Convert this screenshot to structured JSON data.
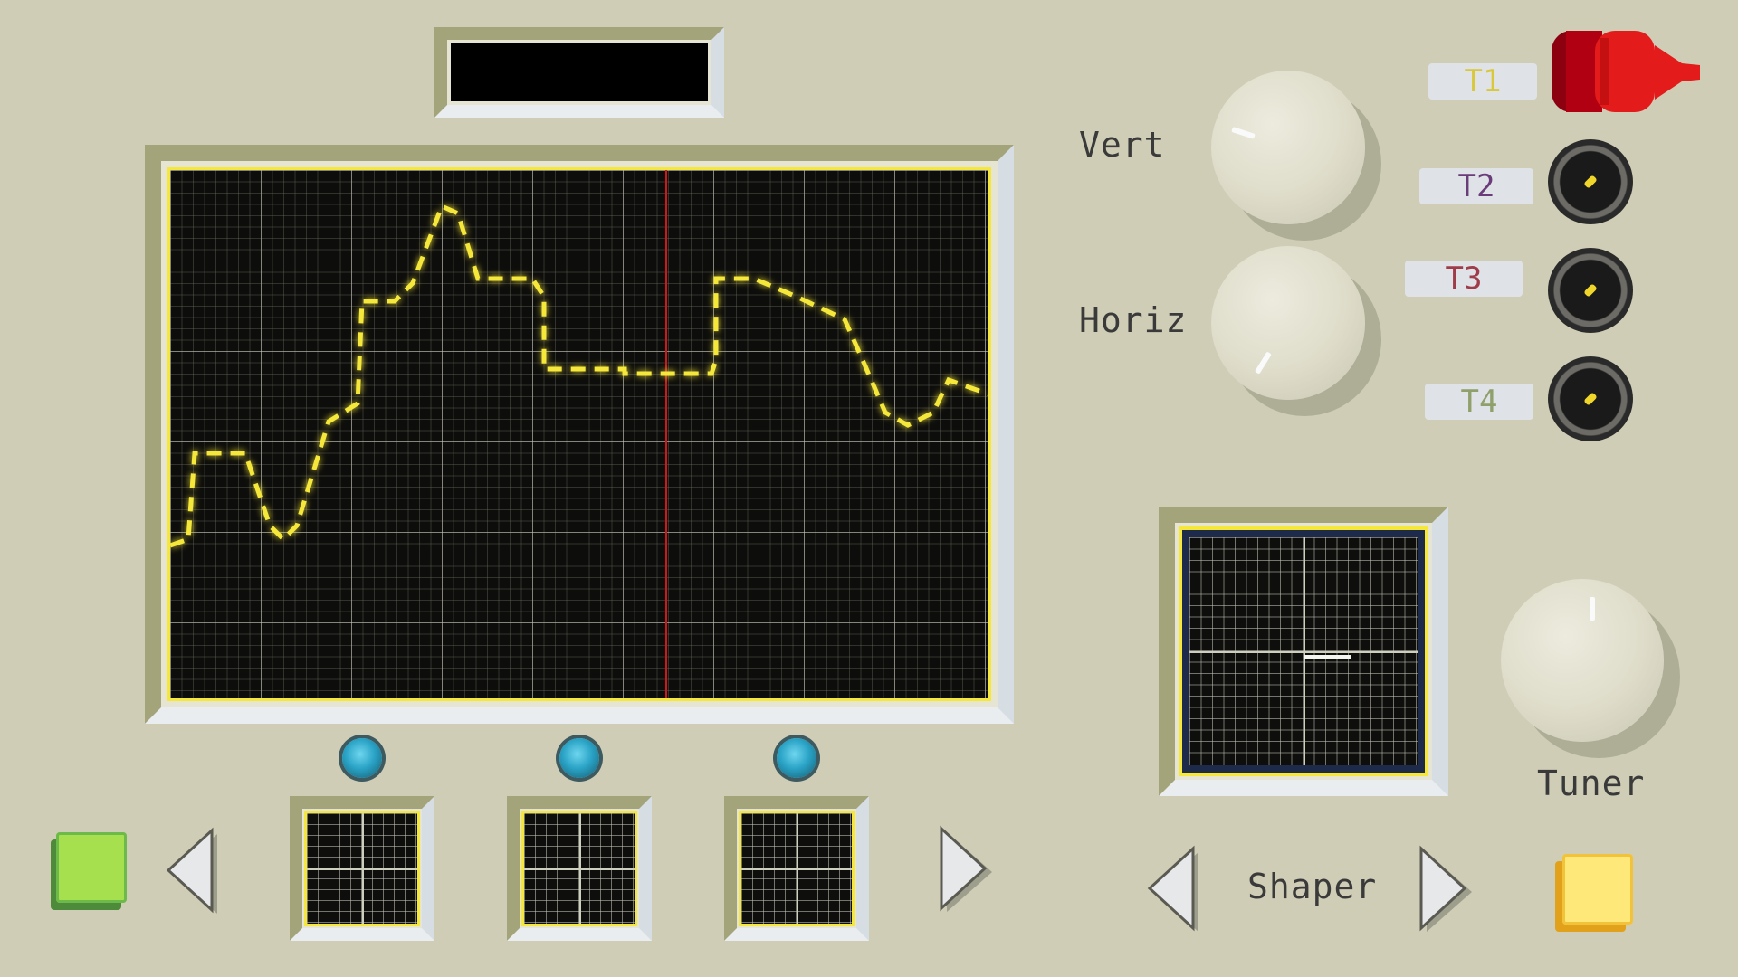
{
  "display": {
    "readout": ""
  },
  "controls": {
    "vert_label": "Vert",
    "horiz_label": "Horiz",
    "tuner_label": "Tuner",
    "shaper_label": "Shaper"
  },
  "tracks": [
    {
      "label": "T1",
      "color": "#d8c83a",
      "active": true
    },
    {
      "label": "T2",
      "color": "#6a3c7a",
      "active": false
    },
    {
      "label": "T3",
      "color": "#a03c4a",
      "active": false
    },
    {
      "label": "T4",
      "color": "#8fa06a",
      "active": false
    }
  ],
  "colors": {
    "panel": "#cfcdb6",
    "screen_bg": "#0d0d0b",
    "trace": "#f5e83a",
    "cursor": "#d01818",
    "green_button": "#a6e04e",
    "yellow_button": "#ffe87a",
    "led": "#2aa3c6"
  },
  "icons": {
    "left_arrow": "left-arrow-icon",
    "right_arrow": "right-arrow-icon",
    "plug": "plug-icon"
  }
}
